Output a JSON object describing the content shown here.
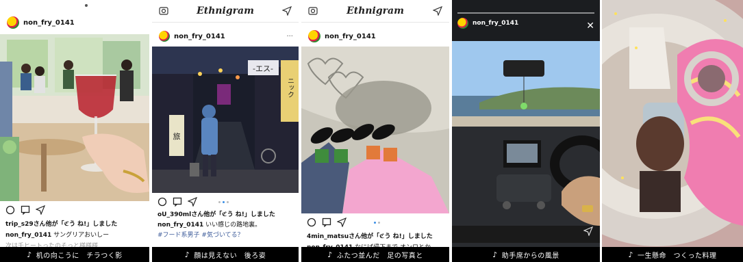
{
  "panels": [
    {
      "username": "non_fry_0141",
      "likes_line": "trip_s29さん他が「ℭう ね!」しました",
      "caption_user": "non_fry_0141",
      "caption_text": "サングリアおいしー",
      "faded_line": "次は千ヒートったのそっと様様様",
      "bottom_caption": "机の向こうに　チラつく影"
    },
    {
      "app_title": "Ethnigram",
      "username": "non_fry_0141",
      "likes_line": "oU_390mlさん他が「ℭう ね!」しました",
      "caption_user": "non_fry_0141",
      "caption_text": "いい感じの路地裏。",
      "hashtags": "#フード系男子 #気づいてる？",
      "bottom_caption": "顔は見えない　後ろ姿",
      "sign_text": "-エス-",
      "sign_text2": "ニック",
      "lantern_text": "旅"
    },
    {
      "app_title": "Ethnigram",
      "username": "non_fry_0141",
      "likes_line": "4min_matsuさん他が「ℭう ね!」しました",
      "caption_user": "non_fry_0141",
      "caption_text": "なにば帰下まで オンロとか",
      "bottom_caption": "ふたつ並んだ　足の写真と"
    },
    {
      "username": "non_fry_0141",
      "bottom_caption": "助手席からの風景"
    },
    {
      "bottom_caption": "一生懸命　つくった料理"
    }
  ],
  "music_note": "♪",
  "colors": {
    "link": "#3b5a99",
    "active_dot": "#3a8ee6",
    "caption_bg": "#000000"
  }
}
